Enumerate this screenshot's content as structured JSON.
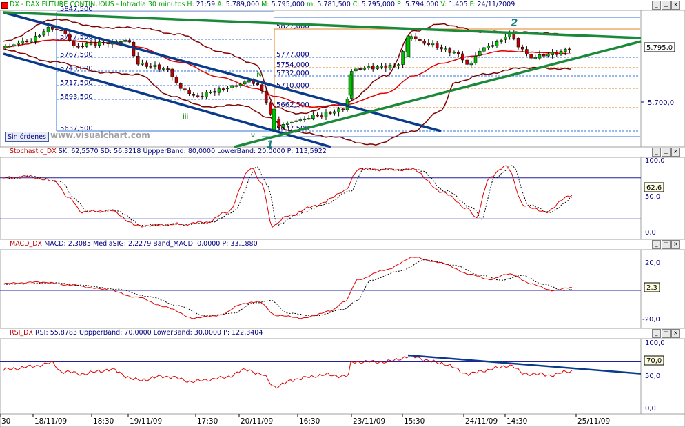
{
  "window_controls": {
    "minimize": "_",
    "maximize": "□",
    "close": "×"
  },
  "panels": {
    "price": {
      "title": "DX - DAX FUTURE CONTINUOUS - Intradía 30 minutos",
      "fields": [
        {
          "k": "H:",
          "v": "21:59"
        },
        {
          "k": "A:",
          "v": "5.789,000"
        },
        {
          "k": "M:",
          "v": "5.795,000"
        },
        {
          "k": "m:",
          "v": "5.781,500"
        },
        {
          "k": "C:",
          "v": "5.795,000"
        },
        {
          "k": "P:",
          "v": "5.794,000"
        },
        {
          "k": "V:",
          "v": "1.405"
        },
        {
          "k": "F:",
          "v": "24/11/2009"
        }
      ],
      "last_value": "5.795,0",
      "y_ticks": [
        "5.700,0"
      ],
      "levels_left": [
        "5847,500",
        "5777,500",
        "5767,500",
        "5743,000",
        "5717,500",
        "5693,500",
        "5637,500"
      ],
      "levels_right": [
        "5827,000",
        "5777,000",
        "5754,000",
        "5732,000",
        "5710,000",
        "5662,500",
        "5637,500"
      ],
      "wave_labels": [
        "iii",
        "iv",
        "v",
        "1",
        "2"
      ],
      "sin_ordenes": "Sin órdenes",
      "watermark": "www.visualchart.com"
    },
    "stochastic": {
      "title": "Stochastic_DX",
      "fields": [
        {
          "k": "SK:",
          "v": "62,5570"
        },
        {
          "k": "SD:",
          "v": "56,3218"
        },
        {
          "k": "UppperBand:",
          "v": "80,0000"
        },
        {
          "k": "LowerBand:",
          "v": "20,0000"
        },
        {
          "k": "P:",
          "v": "113,5922"
        }
      ],
      "last_value": "62,6",
      "y_ticks": [
        "100,0",
        "50,0",
        "0,0"
      ]
    },
    "macd": {
      "title": "MACD_DX",
      "fields": [
        {
          "k": "MACD:",
          "v": "2,3085"
        },
        {
          "k": "MediaSIG:",
          "v": "2,2279"
        },
        {
          "k": "Band_MACD:",
          "v": "0,0000"
        },
        {
          "k": "P:",
          "v": "33,1880"
        }
      ],
      "last_value": "2,3",
      "y_ticks": [
        "20,0",
        "-20,0"
      ]
    },
    "rsi": {
      "title": "RSI_DX",
      "fields": [
        {
          "k": "RSI:",
          "v": "55,8783"
        },
        {
          "k": "UppperBand:",
          "v": "70,0000"
        },
        {
          "k": "LowerBand:",
          "v": "30,0000"
        },
        {
          "k": "P:",
          "v": "122,3404"
        }
      ],
      "last_value": "70,0",
      "y_ticks": [
        "100,0",
        "50,0",
        "0,0"
      ]
    }
  },
  "x_axis_labels": [
    "30",
    "18/11/09",
    "18:30",
    "19/11/09",
    "17:30",
    "20/11/09",
    "16:30",
    "23/11/09",
    "15:30",
    "24/11/09",
    "14:30",
    "25/11/09"
  ],
  "colors": {
    "price_up": "#00c000",
    "price_down": "#c00000",
    "moving_average": "#e00000",
    "bollinger": "#800000",
    "channel": "#0a3a8a",
    "trendline": "#1a8a3a",
    "fib_blue": "#3070e0",
    "fib_orange": "#e08020",
    "band_line": "#2020a0",
    "signal_dotted": "#000000",
    "indicator_main": "#e00000",
    "resistance_rsi": "#0a3a8a"
  },
  "chart_data": [
    {
      "type": "line",
      "title": "DX - DAX FUTURE CONTINUOUS - Intradía 30 minutos",
      "x": [
        "18/11/09",
        "18:30",
        "19/11/09",
        "17:30",
        "20/11/09",
        "16:30",
        "23/11/09",
        "15:30",
        "24/11/09",
        "14:30"
      ],
      "series": [
        {
          "values": [
            5795,
            5775,
            5740,
            5705,
            5715,
            5640,
            5665,
            5800,
            5790,
            5795
          ]
        }
      ],
      "ylim": [
        5620,
        5860
      ]
    },
    {
      "type": "line",
      "title": "Stochastic_DX",
      "series": [
        {
          "name": "SK",
          "values": [
            75,
            50,
            20,
            20,
            95,
            20,
            60,
            90,
            85,
            25,
            95,
            30,
            62.6
          ]
        }
      ],
      "bands": [
        80,
        20
      ],
      "ylim": [
        0,
        100
      ]
    },
    {
      "type": "line",
      "title": "MACD_DX",
      "series": [
        {
          "name": "MACD",
          "values": [
            3,
            0,
            -10,
            -20,
            -5,
            -20,
            -15,
            24,
            8,
            2.3
          ]
        }
      ],
      "bands": [
        0
      ],
      "ylim": [
        -25,
        25
      ]
    },
    {
      "type": "line",
      "title": "RSI_DX",
      "series": [
        {
          "name": "RSI",
          "values": [
            60,
            50,
            40,
            45,
            60,
            35,
            50,
            75,
            55,
            50,
            55.9
          ]
        }
      ],
      "bands": [
        70,
        30
      ],
      "ylim": [
        0,
        100
      ]
    }
  ]
}
